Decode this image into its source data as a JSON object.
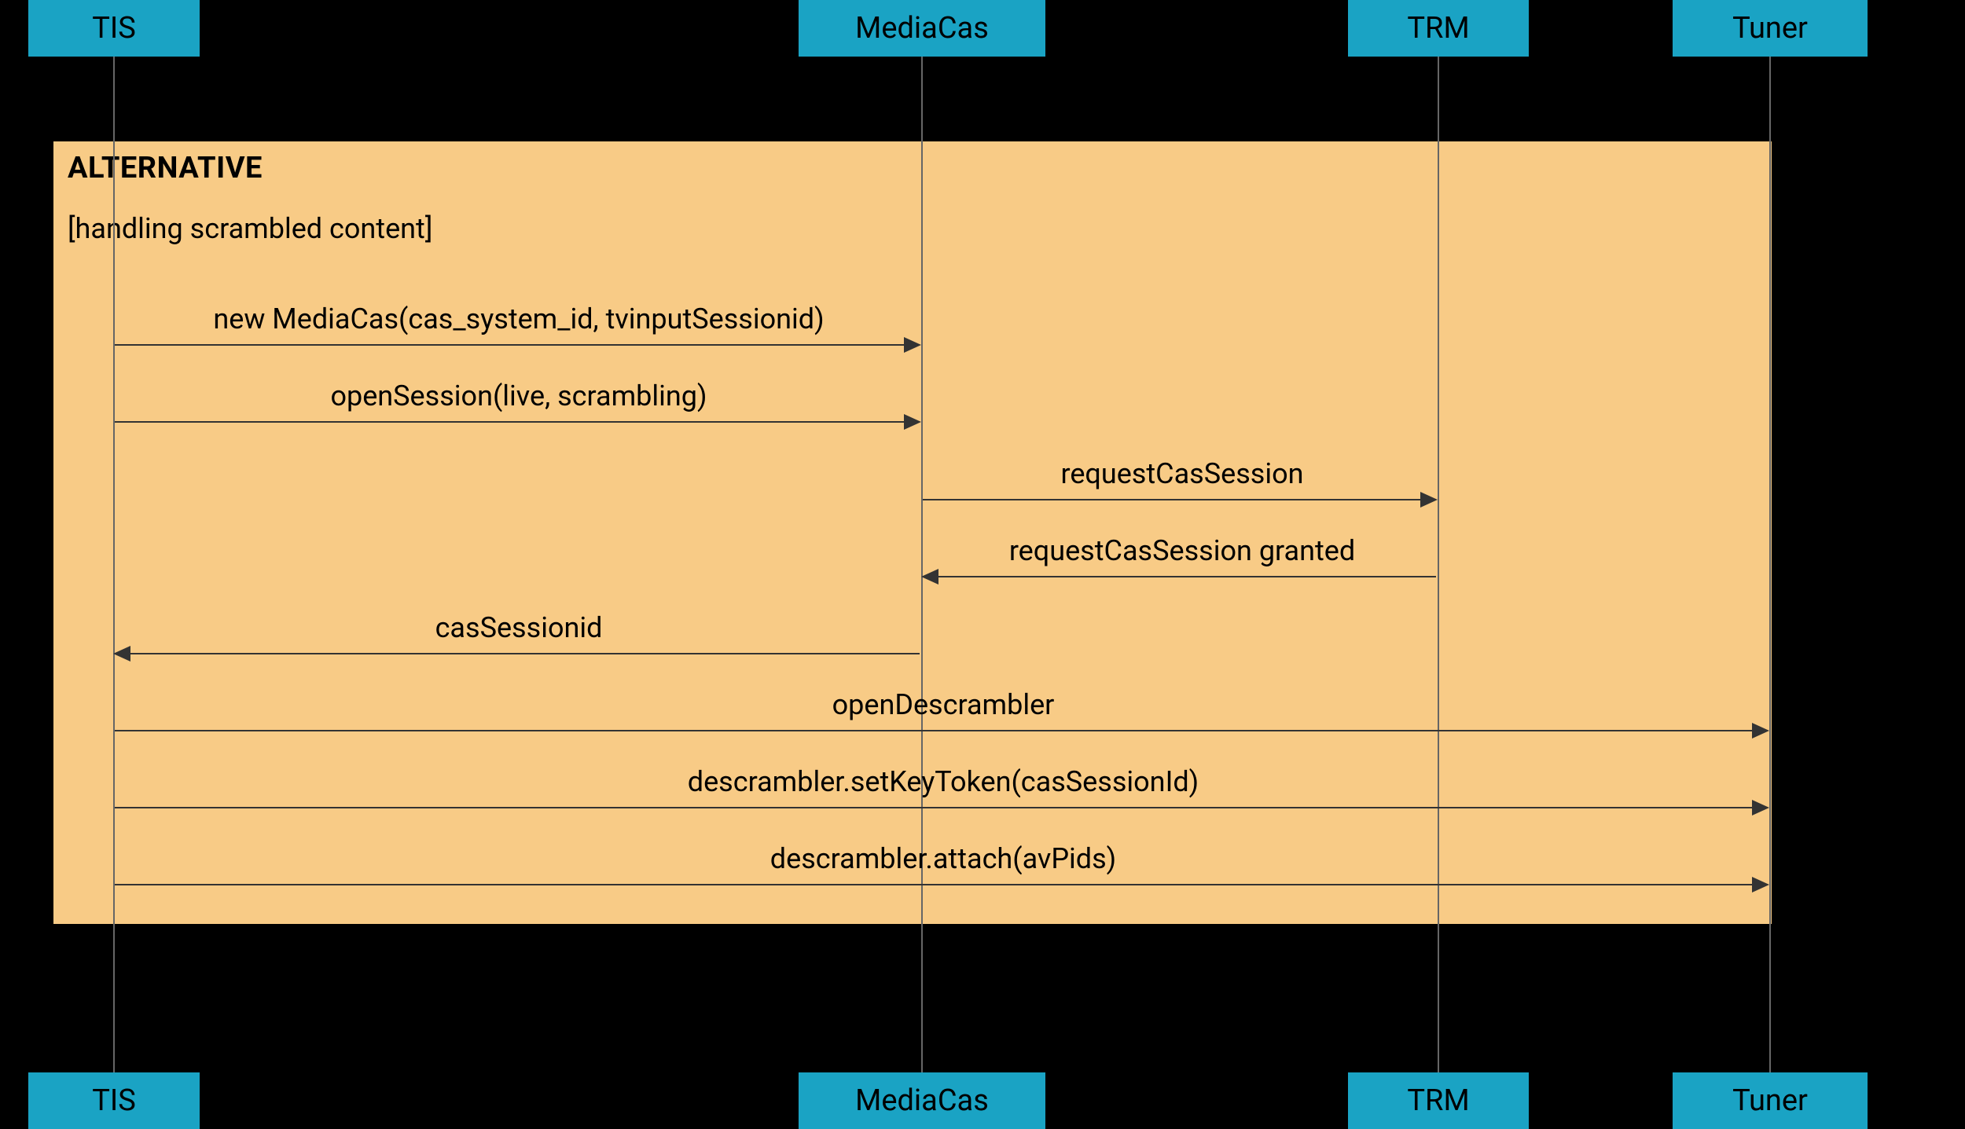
{
  "participants": {
    "p0": "TIS",
    "p1": "MediaCas",
    "p2": "TRM",
    "p3": "Tuner"
  },
  "fragment": {
    "title": "ALTERNATIVE",
    "guard": "[handling scrambled content]"
  },
  "messages": {
    "m0": "new MediaCas(cas_system_id, tvinputSessionid)",
    "m1": "openSession(live, scrambling)",
    "m2": "requestCasSession",
    "m3": "requestCasSession granted",
    "m4": "casSessionid",
    "m5": "openDescrambler",
    "m6": "descrambler.setKeyToken(casSessionId)",
    "m7": "descrambler.attach(avPids)"
  },
  "colors": {
    "participant_bg": "#1aa3c4",
    "fragment_bg": "#f8cb86",
    "background": "#000000"
  }
}
